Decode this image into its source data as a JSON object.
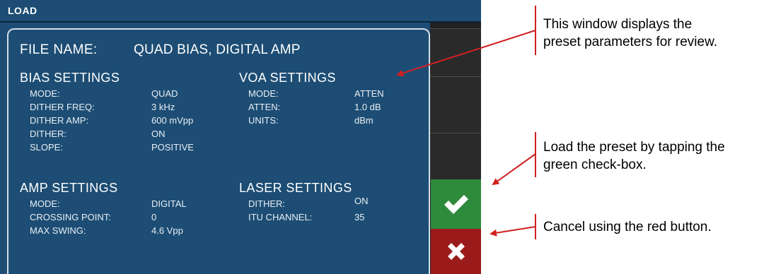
{
  "window": {
    "title": "LOAD"
  },
  "dialog": {
    "file_label": "FILE NAME:",
    "file_value": "QUAD BIAS, DIGITAL AMP",
    "bias": {
      "heading": "BIAS SETTINGS",
      "rows": [
        {
          "label": "MODE:",
          "value": "QUAD"
        },
        {
          "label": "DITHER FREQ:",
          "value": "3 kHz"
        },
        {
          "label": "DITHER AMP:",
          "value": "600 mVpp"
        },
        {
          "label": "DITHER:",
          "value": "ON"
        },
        {
          "label": "SLOPE:",
          "value": "POSITIVE"
        }
      ]
    },
    "voa": {
      "heading": "VOA SETTINGS",
      "rows": [
        {
          "label": "MODE:",
          "value": "ATTEN"
        },
        {
          "label": "ATTEN:",
          "value": "1.0 dB"
        },
        {
          "label": "UNITS:",
          "value": "dBm"
        }
      ]
    },
    "amp": {
      "heading": "AMP SETTINGS",
      "rows": [
        {
          "label": "MODE:",
          "value": "DIGITAL"
        },
        {
          "label": "CROSSING POINT:",
          "value": "0"
        },
        {
          "label": "MAX SWING:",
          "value": "4.6 Vpp"
        }
      ]
    },
    "laser": {
      "heading": "LASER SETTINGS",
      "rows": [
        {
          "label": "DITHER:",
          "value": "ON"
        },
        {
          "label": "ITU CHANNEL:",
          "value": "35"
        }
      ]
    }
  },
  "buttons": {
    "confirm_icon": "checkmark-icon",
    "cancel_icon": "x-icon",
    "confirm_color": "#2e8b3c",
    "cancel_color": "#9b1b1b"
  },
  "annotations": {
    "review": [
      "This window displays the",
      "preset parameters for review."
    ],
    "load": [
      "Load the preset by tapping the",
      "green check-box."
    ],
    "cancel": [
      "Cancel using the red button."
    ]
  },
  "colors": {
    "screen_bg": "#1d4d74",
    "annotation_red": "#d02020"
  }
}
